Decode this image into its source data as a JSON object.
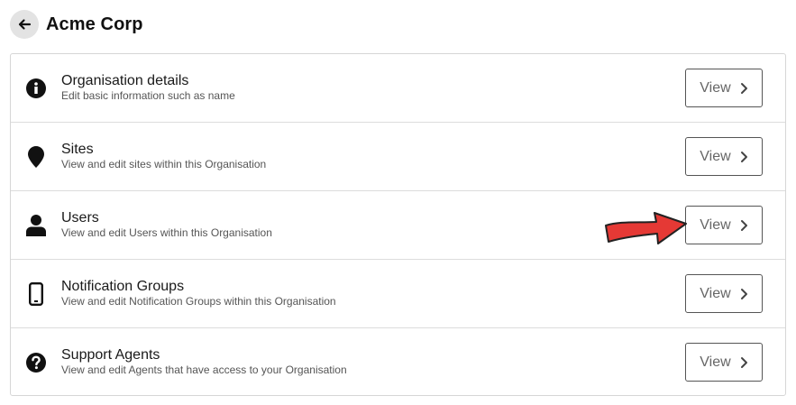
{
  "header": {
    "title": "Acme Corp",
    "back_icon": "arrow-left-icon"
  },
  "colors": {
    "annotation_arrow": "#e53935",
    "back_button_bg": "#e3e3e3"
  },
  "rows": [
    {
      "title": "Organisation details",
      "description": "Edit basic information such as name",
      "icon": "info-icon",
      "button_label": "View"
    },
    {
      "title": "Sites",
      "description": "View and edit sites within this Organisation",
      "icon": "map-pin-icon",
      "button_label": "View"
    },
    {
      "title": "Users",
      "description": "View and edit Users within this Organisation",
      "icon": "user-icon",
      "button_label": "View"
    },
    {
      "title": "Notification Groups",
      "description": "View and edit Notification Groups within this Organisation",
      "icon": "mobile-phone-icon",
      "button_label": "View"
    },
    {
      "title": "Support Agents",
      "description": "View and edit Agents that have access to your Organisation",
      "icon": "question-icon",
      "button_label": "View"
    }
  ]
}
